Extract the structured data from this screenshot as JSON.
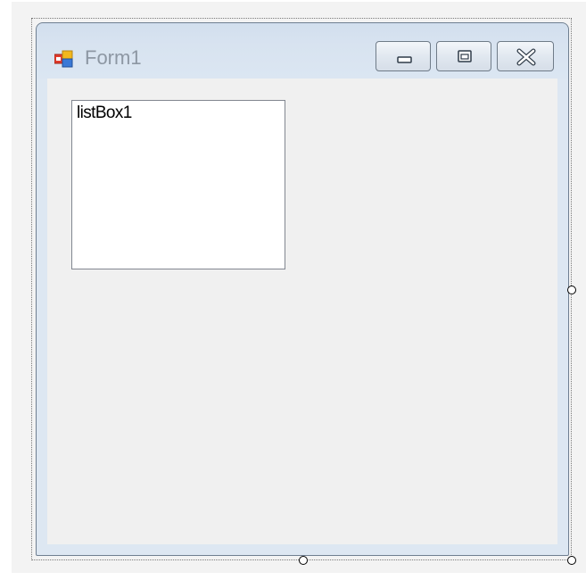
{
  "window": {
    "title": "Form1",
    "icon": "form-window-icon"
  },
  "caption_buttons": {
    "minimize_icon": "minimize-icon",
    "maximize_icon": "maximize-icon",
    "close_icon": "close-icon"
  },
  "listbox": {
    "items": [
      "listBox1"
    ]
  },
  "colors": {
    "title_text": "#8d97a3",
    "client_background": "#f0f0f0",
    "frame_border": "#dde7f2"
  }
}
